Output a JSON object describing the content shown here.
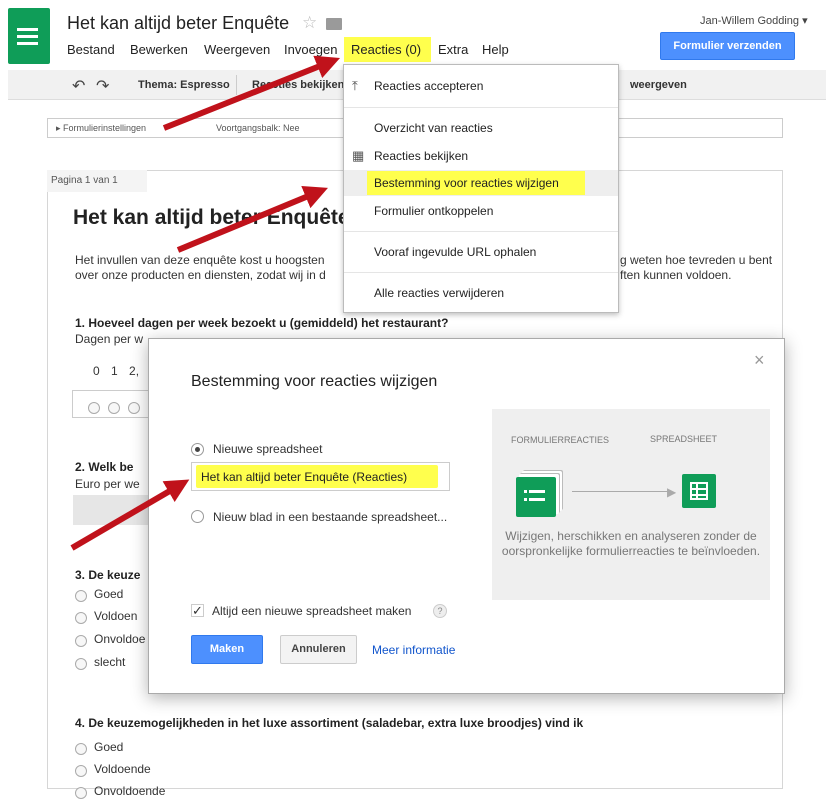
{
  "header": {
    "title": "Het kan altijd beter Enquête",
    "user": "Jan-Willem Godding ▾",
    "send_button": "Formulier verzenden",
    "star_icon": "☆",
    "menus": [
      "Bestand",
      "Bewerken",
      "Weergeven",
      "Invoegen",
      "Reacties (0)",
      "Extra",
      "Help"
    ]
  },
  "toolbar": {
    "undo": "↶",
    "redo": "↷",
    "theme": "Thema: Espresso",
    "view_responses": "Reacties bekijken",
    "right_label": "weergeven"
  },
  "settings": {
    "form_settings": "▸  Formulierinstellingen",
    "progress": "Voortgangsbalk: Nee"
  },
  "page": {
    "page_label": "Pagina 1 van 1",
    "form_title": "Het kan altijd beter Enquête",
    "intro_line1_left": "Het invullen van deze enquête kost u hoogsten",
    "intro_line1_right": "g weten hoe tevreden u bent",
    "intro_line2_left": "over onze producten en diensten, zodat wij in d",
    "intro_line2_right": "ften kunnen voldoen.",
    "q1": "1. Hoeveel dagen per week bezoekt u (gemiddeld) het restaurant?",
    "q1_sub": "Dagen per w",
    "q1_scale": "0 1 2,",
    "q2": "2. Welk be",
    "q2_sub": "Euro per we",
    "q3": "3. De keuze",
    "q3_options": [
      "Goed",
      "Voldoen",
      "Onvoldoe",
      "slecht"
    ],
    "q4": "4. De keuzemogelijkheden in het luxe assortiment (saladebar, extra luxe broodjes) vind ik",
    "q4_options": [
      "Goed",
      "Voldoende",
      "Onvoldoende"
    ]
  },
  "dropdown": {
    "accept": "Reacties accepteren",
    "overview": "Overzicht van reacties",
    "view": "Reacties bekijken",
    "change_destination": "Bestemming voor reacties wijzigen",
    "unlink": "Formulier ontkoppelen",
    "prefilled": "Vooraf ingevulde URL ophalen",
    "delete_all": "Alle reacties verwijderen"
  },
  "dialog": {
    "title": "Bestemming voor reacties wijzigen",
    "close": "×",
    "option_new": "Nieuwe spreadsheet",
    "new_name": "Het kan altijd beter  Enquête (Reacties)",
    "option_existing": "Nieuw blad in een bestaande spreadsheet...",
    "always_new": "Altijd een nieuwe spreadsheet maken",
    "help": "?",
    "make_button": "Maken",
    "cancel_button": "Annuleren",
    "more_info": "Meer informatie",
    "panel_form_label": "FORMULIERREACTIES",
    "panel_sheet_label": "SPREADSHEET",
    "panel_desc": "Wijzigen, herschikken en analyseren zonder de oorspronkelijke formulierreacties te beïnvloeden."
  },
  "colors": {
    "highlight": "#ffff4d",
    "brand_green": "#0f9d58",
    "primary_blue": "#4d90fe",
    "annotation_red": "#c0121b"
  }
}
